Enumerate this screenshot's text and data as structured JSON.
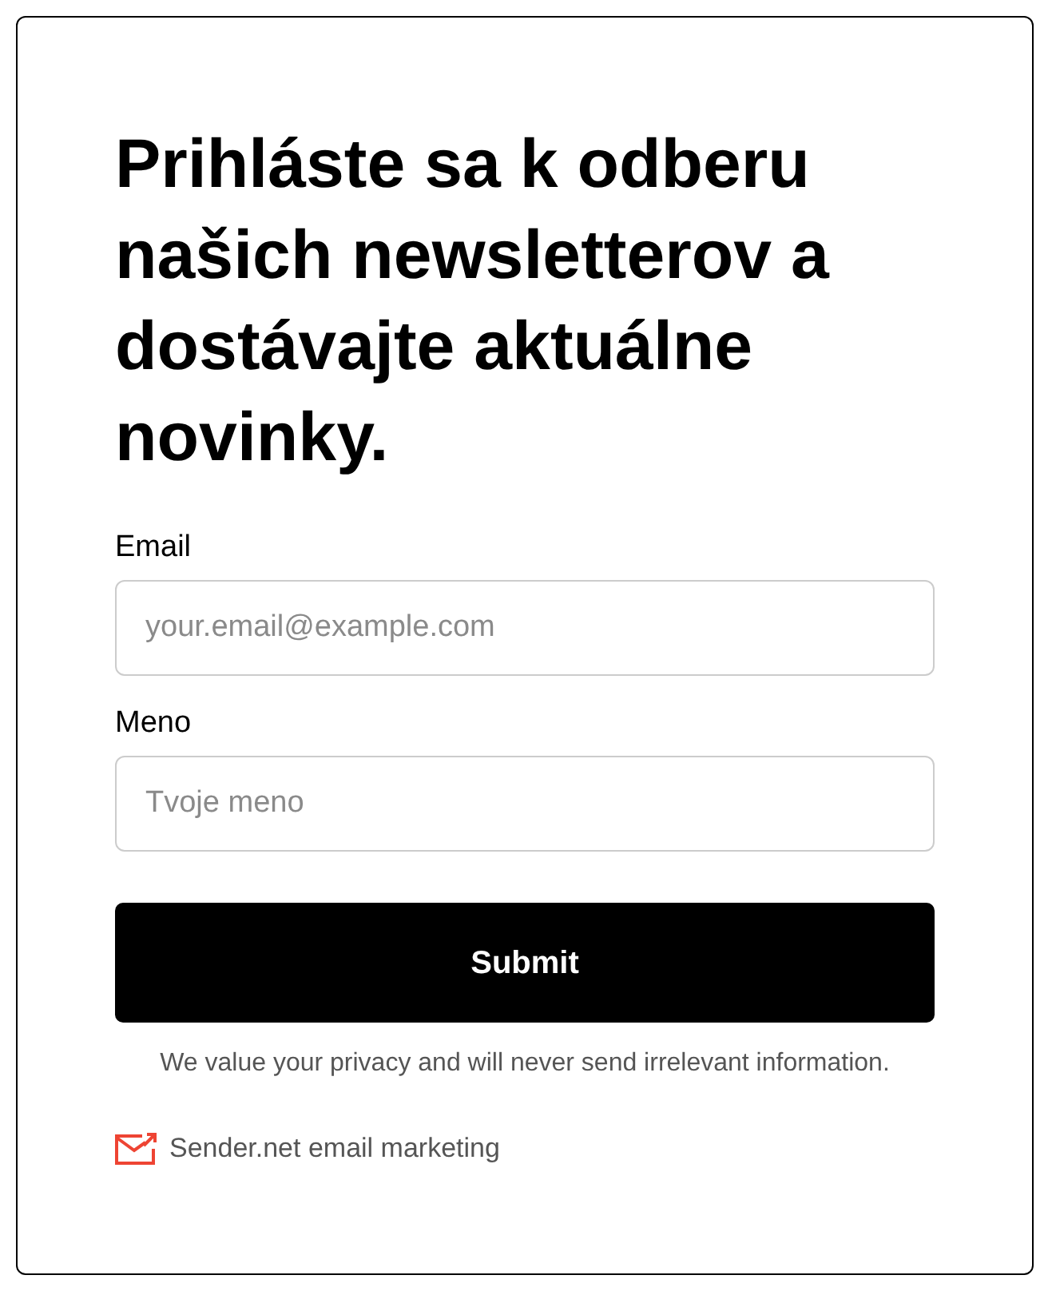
{
  "heading": "Prihláste sa k odberu našich newsletterov a dostávajte aktuálne novinky.",
  "fields": [
    {
      "label": "Email",
      "placeholder": "your.email@example.com"
    },
    {
      "label": "Meno",
      "placeholder": "Tvoje meno"
    }
  ],
  "submit": "Submit",
  "privacy": "We value your privacy and will never send irrelevant information.",
  "branding": "Sender.net email marketing"
}
